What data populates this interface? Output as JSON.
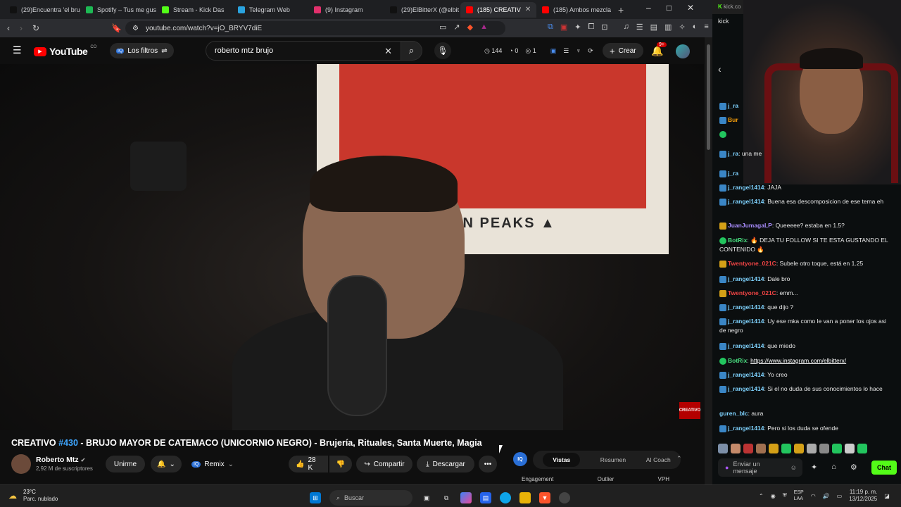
{
  "browser": {
    "tabs": [
      {
        "label": "(29)Encuentra 'el bruj",
        "color": "#111111"
      },
      {
        "label": "Spotify – Tus me gust",
        "color": "#1db954"
      },
      {
        "label": "Stream - Kick Das",
        "color": "#53fc18"
      },
      {
        "label": "Telegram Web",
        "color": "#2aa3df"
      },
      {
        "label": "(9) Instagram",
        "color": "#e1306c"
      },
      {
        "label": "(29)ElBitterX (@elbit",
        "color": "#111111"
      },
      {
        "label": "(185) CREATIV",
        "color": "#ff0000"
      },
      {
        "label": "(185) Ambos mezcla",
        "color": "#ff0000"
      }
    ],
    "new_tab": "+",
    "url": "youtube.com/watch?v=jO_BRYV7diE",
    "window_controls": [
      "–",
      "□",
      "✕"
    ]
  },
  "youtube": {
    "logo_text": "YouTube",
    "logo_region": "CO",
    "filters_label": "Los filtros",
    "search_value": "roberto mtz brujo",
    "stats": {
      "views": "144",
      "likes": "0",
      "watching": "1"
    },
    "create_label": "Crear",
    "notif_count": "9+"
  },
  "video": {
    "poster_text": "IN PEAKS ▲",
    "badge_text": "CREATIVO",
    "title_prefix": "CREATIVO ",
    "title_episode": "#430",
    "title_rest": " - BRUJO MAYOR DE CATEMACO (UNICORNIO NEGRO) - Brujería, Rituales, Santa Muerte, Magia",
    "channel_name": "Roberto Mtz",
    "subscribers": "2,92 M de suscriptores",
    "join_label": "Unirme",
    "remix_label": "Remix",
    "likes": "28 K",
    "share_label": "Compartir",
    "download_label": "Descargar",
    "more_label": "•••"
  },
  "iq_panel": {
    "logo": "IQ",
    "tabs": [
      "Vistas",
      "Resumen",
      "AI Coach"
    ],
    "columns": [
      "Engagement",
      "Outlier",
      "VPH"
    ]
  },
  "kick": {
    "url": "kick.co",
    "header_text": "kick",
    "chat": [
      {
        "user": "j_ra",
        "text": "",
        "user_color": "#7fd3ff",
        "badge": "blue"
      },
      {
        "user": "Bur",
        "text": "",
        "user_color": "#f59e0b",
        "badge": "blue"
      },
      {
        "user": "",
        "text": "",
        "user_color": "#7fd3ff",
        "badge": "green"
      },
      {
        "user": "j_ra",
        "text": "una me",
        "user_color": "#7fd3ff",
        "badge": "blue"
      },
      {
        "user": "j_ra",
        "text": "",
        "user_color": "#7fd3ff",
        "badge": "blue"
      },
      {
        "user": "j_rangel1414",
        "text": "JAJA",
        "user_color": "#7fd3ff",
        "badge": "blue"
      },
      {
        "user": "j_rangel1414",
        "text": "Buena esa descomposicion de ese tema eh",
        "user_color": "#7fd3ff",
        "badge": "blue"
      },
      {
        "user": "JuanJumagaLP",
        "text": "Queeeee? estaba en 1.5?",
        "user_color": "#a78bfa",
        "badge": "yellow"
      },
      {
        "user": "BotRix",
        "text": "🔥 DEJA TU FOLLOW SI TE ESTA GUSTANDO EL CONTENIDO 🔥",
        "user_color": "#4ade80",
        "badge": "green"
      },
      {
        "user": "Twentyone_021C",
        "text": "Subele otro toque, está en 1.25",
        "user_color": "#ef4444",
        "badge": "yellow"
      },
      {
        "user": "j_rangel1414",
        "text": "Dale bro",
        "user_color": "#7fd3ff",
        "badge": "blue"
      },
      {
        "user": "Twentyone_021C",
        "text": "emm...",
        "user_color": "#ef4444",
        "badge": "yellow"
      },
      {
        "user": "j_rangel1414",
        "text": "que dijo ?",
        "user_color": "#7fd3ff",
        "badge": "blue"
      },
      {
        "user": "j_rangel1414",
        "text": "Uy ese mka como le van a poner los ojos asi de negro",
        "user_color": "#7fd3ff",
        "badge": "blue"
      },
      {
        "user": "j_rangel1414",
        "text": "que miedo",
        "user_color": "#7fd3ff",
        "badge": "blue"
      },
      {
        "user": "BotRix",
        "text": "https://www.instagram.com/elbitterx/",
        "user_color": "#4ade80",
        "badge": "green"
      },
      {
        "user": "j_rangel1414",
        "text": "Yo creo",
        "user_color": "#7fd3ff",
        "badge": "blue"
      },
      {
        "user": "j_rangel1414",
        "text": "Si el no duda de sus conocimientos lo hace",
        "user_color": "#7fd3ff",
        "badge": "blue"
      },
      {
        "user": "guren_blc",
        "text": "aura",
        "user_color": "#7fd3ff",
        "badge": "none"
      },
      {
        "user": "j_rangel1414",
        "text": "Pero si los duda se ofende",
        "user_color": "#7fd3ff",
        "badge": "blue"
      }
    ],
    "input_placeholder": "Enviar un mensaje",
    "chat_button": "Chat"
  },
  "taskbar": {
    "temp": "23°C",
    "weather": "Parc. nublado",
    "search_label": "Buscar",
    "lang": "ESP",
    "lang2": "LAA",
    "time": "11:19 p. m.",
    "date": "13/12/2025"
  }
}
